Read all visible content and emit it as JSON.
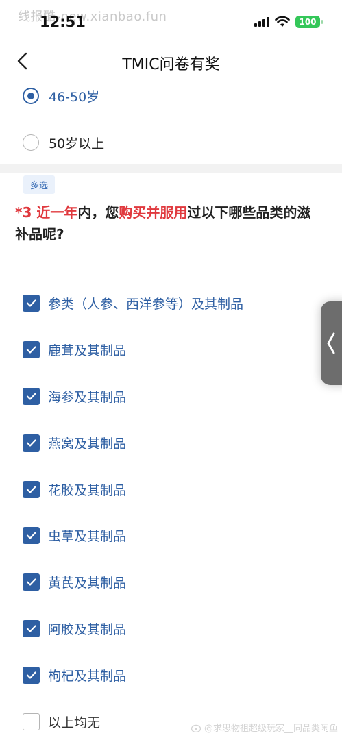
{
  "watermark_top": "线报酷-new.xianbao.fun",
  "status_bar": {
    "time": "12:51",
    "battery": "100"
  },
  "nav": {
    "title": "TMIC问卷有奖",
    "back_icon": "chevron-left-icon"
  },
  "age_options": [
    {
      "label": "46-50岁",
      "selected": true
    },
    {
      "label": "50岁以上",
      "selected": false
    }
  ],
  "question": {
    "tag": "多选",
    "required_mark": "*",
    "number": "3",
    "part1": "近一年",
    "part2": "内，您",
    "part3": "购买并服用",
    "part4": "过以下哪些品类的滋补品呢?"
  },
  "options": [
    {
      "label": "参类（人参、西洋参等）及其制品",
      "checked": true
    },
    {
      "label": "鹿茸及其制品",
      "checked": true
    },
    {
      "label": "海参及其制品",
      "checked": true
    },
    {
      "label": "燕窝及其制品",
      "checked": true
    },
    {
      "label": "花胶及其制品",
      "checked": true
    },
    {
      "label": "虫草及其制品",
      "checked": true
    },
    {
      "label": "黄芪及其制品",
      "checked": true
    },
    {
      "label": "阿胶及其制品",
      "checked": true
    },
    {
      "label": "枸杞及其制品",
      "checked": true
    },
    {
      "label": "以上均无",
      "checked": false
    }
  ],
  "watermark_bottom": "@求思物祖超级玩家__同品类闲鱼",
  "colors": {
    "accent": "#2e5fa3",
    "required": "#e0393e",
    "battery": "#34c759"
  }
}
